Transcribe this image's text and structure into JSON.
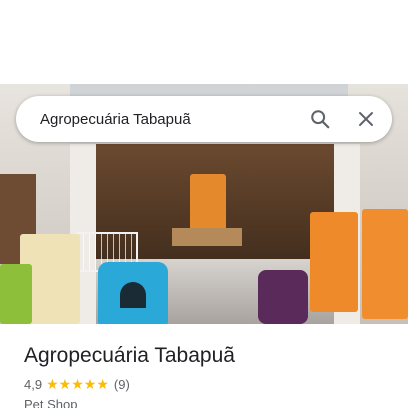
{
  "search": {
    "query": "Agropecuária Tabapuã",
    "search_icon": "search-icon",
    "close_icon": "close-icon"
  },
  "place": {
    "name": "Agropecuária Tabapuã",
    "rating": "4,9",
    "stars": 5,
    "review_count": "(9)",
    "category": "Pet Shop"
  },
  "colors": {
    "star": "#fbbc04",
    "title_text": "#202124",
    "secondary_text": "#5f6368"
  }
}
